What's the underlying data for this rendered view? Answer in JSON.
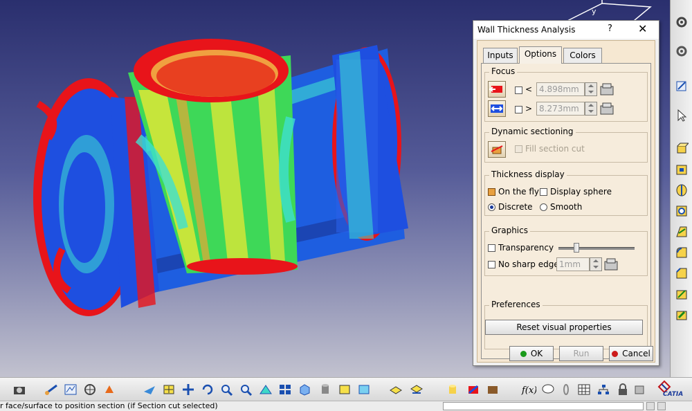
{
  "dialog": {
    "title": "Wall Thickness Analysis",
    "help": "?",
    "close": "✕",
    "tabs": [
      {
        "label": "Inputs",
        "active": false
      },
      {
        "label": "Options",
        "active": true
      },
      {
        "label": "Colors",
        "active": false
      }
    ],
    "focus": {
      "title": "Focus",
      "less_symbol": "<",
      "less_value": "4.898mm",
      "greater_symbol": ">",
      "greater_value": "8.273mm"
    },
    "dynamic_sectioning": {
      "title": "Dynamic sectioning",
      "fill_section_cut": "Fill section cut"
    },
    "thickness_display": {
      "title": "Thickness display",
      "on_the_fly": "On the fly",
      "display_sphere": "Display sphere",
      "discrete": "Discrete",
      "smooth": "Smooth"
    },
    "graphics": {
      "title": "Graphics",
      "transparency": "Transparency",
      "no_sharp_edge": "No sharp edge",
      "sharp_edge_value": "1mm",
      "transparency_level": 0.2
    },
    "preferences": {
      "title": "Preferences",
      "reset": "Reset visual properties"
    },
    "ok": "OK",
    "run": "Run",
    "cancel": "Cancel"
  },
  "status": {
    "text": "r face/surface to position section (if Section cut selected)"
  },
  "branding": {
    "catia": "CATIA"
  },
  "colors": {
    "red": "#e8141a",
    "blue": "#1e4fe0",
    "green": "#3ed858",
    "yellow": "#e8e834",
    "cyan": "#3ee0d0",
    "accent_ok": "#1a9a1a",
    "accent_cancel": "#cc1a1a"
  },
  "icons": {
    "right_toolbar": [
      "settings-gear-icon",
      "sketch-icon",
      "select-arrow-icon",
      "pad-icon",
      "pocket-icon",
      "revolve-icon",
      "hole-icon",
      "draft-icon",
      "fillet-icon",
      "chamfer-icon",
      "shell-icon",
      "thickness-icon"
    ],
    "bottom_toolbar": [
      "camera-icon",
      "measure-icon",
      "pan-icon",
      "zoom-in-icon",
      "zoom-out-icon",
      "rotate-icon",
      "view-icon",
      "cube-icon",
      "cylinder-icon",
      "render-icon",
      "layer-icon",
      "formula-icon",
      "comment-icon",
      "table-icon",
      "tree-icon",
      "lock-icon",
      "catia-logo-icon"
    ]
  }
}
